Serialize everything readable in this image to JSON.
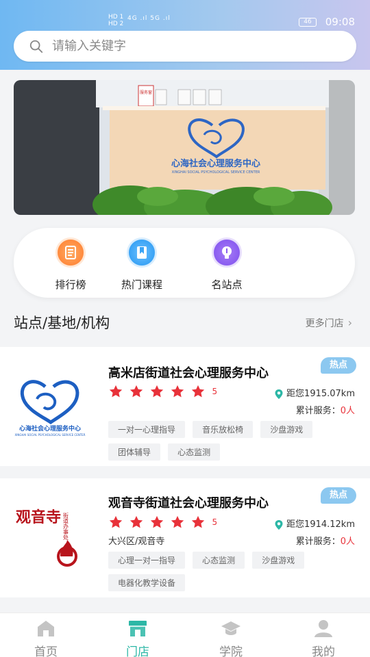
{
  "status_bar": {
    "left_top": "HD 1",
    "left_bottom": "HD 2",
    "signal_text": "4G .ıl 5G .ıl",
    "battery": "46",
    "time": "09:08"
  },
  "search": {
    "placeholder": "请输入关键字"
  },
  "banner": {
    "sign_text": "心海社会心理服务中心",
    "sign_sub": "XINGHAI SOCIAL PSYCHOLOGICAL SERVICE CENTER",
    "board_text": "服务窗"
  },
  "quick_links": [
    {
      "label": "排行榜",
      "icon": "list-icon",
      "color": "#ff8a3d"
    },
    {
      "label": "热门课程",
      "icon": "bookmark-icon",
      "color": "#3aa3f5"
    },
    {
      "label": "名站点",
      "icon": "bulb-icon",
      "color": "#8a5cf0"
    }
  ],
  "section": {
    "title": "站点/基地/机构",
    "more": "更多门店"
  },
  "stores": [
    {
      "name": "高米店街道社会心理服务中心",
      "badge": "热点",
      "rating": "5",
      "distance": "距您1915.07km",
      "served_label": "累计服务：",
      "served_value": "0人",
      "address": "",
      "logo_text": "心海社会心理服务中心",
      "logo_sub": "XINGHAI SOCIAL PSYCHOLOGICAL SERVICE CENTER",
      "tags": [
        "一对一心理指导",
        "音乐放松椅",
        "沙盘游戏",
        "团体辅导",
        "心态监测"
      ]
    },
    {
      "name": "观音寺街道社会心理服务中心",
      "badge": "热点",
      "rating": "5",
      "distance": "距您1914.12km",
      "served_label": "累计服务：",
      "served_value": "0人",
      "address": "大兴区/观音寺",
      "logo_text": "观音寺",
      "logo_sub": "街道办事处",
      "tags": [
        "心理一对一指导",
        "心态监测",
        "沙盘游戏",
        "电器化教学设备"
      ]
    }
  ],
  "tabs": [
    {
      "label": "首页",
      "icon": "home-icon"
    },
    {
      "label": "门店",
      "icon": "store-icon",
      "active": true
    },
    {
      "label": "学院",
      "icon": "graduation-cap-icon"
    },
    {
      "label": "我的",
      "icon": "user-icon"
    }
  ],
  "colors": {
    "accent": "#2cb7a6",
    "star": "#e8323a",
    "badge": "#8cc8f0",
    "pin": "#2cb7a6"
  }
}
